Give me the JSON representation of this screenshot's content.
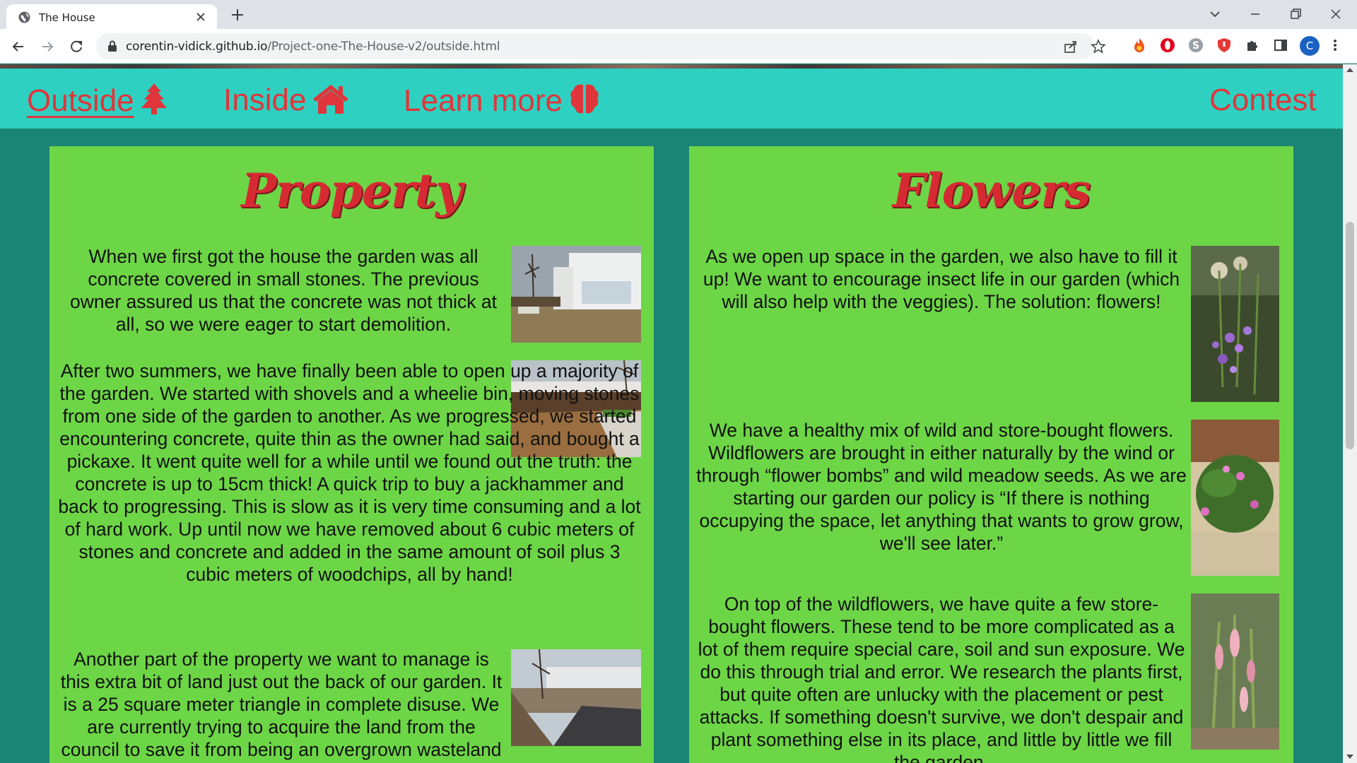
{
  "browser": {
    "tab_title": "The House",
    "url_host": "corentin-vidick.github.io",
    "url_path": "/Project-one-The-House-v2/outside.html",
    "profile_initial": "C"
  },
  "nav": {
    "items": [
      {
        "label": "Outside",
        "icon": "tree-icon",
        "active": true
      },
      {
        "label": "Inside",
        "icon": "house-icon",
        "active": false
      },
      {
        "label": "Learn more",
        "icon": "brain-icon",
        "active": false
      },
      {
        "label": "Contest",
        "icon": "",
        "active": false
      }
    ]
  },
  "property": {
    "title": "Property",
    "paragraphs": [
      "When we first got the house the garden was all concrete covered in small stones. The previous owner assured us that the concrete was not thick at all, so we were eager to start demolition.",
      "After two summers, we have finally been able to open up a majority of the garden. We started with shovels and a wheelie bin, moving stones from one side of the garden to another. As we progressed, we started encountering concrete, quite thin as the owner had said, and bought a pickaxe. It went quite well for a while until we found out the truth: the concrete is up to 15cm thick! A quick trip to buy a jackhammer and back to progressing. This is slow as it is very time consuming and a lot of hard work. Up until now we have removed about 6 cubic meters of stones and concrete and added in the same amount of soil plus 3 cubic meters of woodchips, all by hand!",
      "Another part of the property we want to manage is this extra bit of land just out the back of our garden. It is a 25 square meter triangle in complete disuse. We are currently trying to acquire the land from the council to save it from being an overgrown wasteland full of rubbish."
    ]
  },
  "flowers": {
    "title": "Flowers",
    "paragraphs": [
      "As we open up space in the garden, we also have to fill it up! We want to encourage insect life in our garden (which will also help with the veggies). The solution: flowers!",
      "We have a healthy mix of wild and store-bought flowers. Wildflowers are brought in either naturally by the wind or through “flower bombs” and wild meadow seeds. As we are starting our garden our policy is “If there is nothing occupying the space, let anything that wants to grow grow, we'll see later.”",
      "On top of the wildflowers, we have quite a few store-bought flowers. These tend to be more complicated as a lot of them require special care, soil and sun exposure. We do this through trial and error. We research the plants first, but quite often are unlucky with the placement or pest attacks. If something doesn't survive, we don't despair and plant something else in its place, and little by little we fill the garden."
    ]
  },
  "colors": {
    "navbar": "#2ed1c1",
    "nav_text": "#e0353b",
    "card_bg": "#6dd646",
    "page_bg": "#1a8475",
    "title": "#d62a33"
  }
}
